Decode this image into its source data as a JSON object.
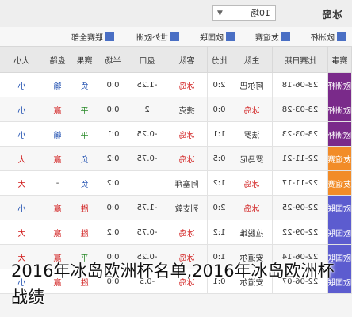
{
  "header": {
    "team": "冰岛",
    "dropdown_value": "10场",
    "filters": [
      "欧洲杯",
      "友谊赛",
      "欧国联",
      "世外欧洲",
      "联赛全部"
    ]
  },
  "table": {
    "columns": [
      "赛事",
      "比赛日期",
      "主队",
      "比分",
      "客队",
      "盘口",
      "半场",
      "赛果",
      "盘路",
      "大小"
    ],
    "rows": [
      {
        "comp": "欧洲杯",
        "date": "23-06-18",
        "home": "阿尔巴",
        "score": "2:0",
        "away": "冰岛",
        "line": "-1.25",
        "half": "0:0",
        "result": "负",
        "handicap": "输",
        "ou": "小"
      },
      {
        "comp": "欧洲杯",
        "date": "23-03-28",
        "home": "冰岛",
        "score": "0:0",
        "away": "捷克",
        "line": "2",
        "half": "0:0",
        "result": "平",
        "handicap": "赢",
        "ou": "小"
      },
      {
        "comp": "欧洲杯",
        "date": "23-03-23",
        "home": "法罗",
        "score": "1:1",
        "away": "冰岛",
        "line": "-0.25",
        "half": "0:1",
        "result": "平",
        "handicap": "输",
        "ou": "小"
      },
      {
        "comp": "友谊赛",
        "date": "22-11-21",
        "home": "罗马尼",
        "score": "0:5",
        "away": "冰岛",
        "line": "-0.75",
        "half": "0:2",
        "result": "负",
        "handicap": "赢",
        "ou": "大"
      },
      {
        "comp": "友谊赛",
        "date": "22-11-17",
        "home": "冰岛",
        "score": "1:2",
        "away": "阿塞拜",
        "line": "",
        "half": "0:2",
        "result": "负",
        "handicap": "-",
        "ou": "大"
      },
      {
        "comp": "欧国联",
        "date": "22-09-25",
        "home": "冰岛",
        "score": "2:0",
        "away": "列支敦",
        "line": "-1.75",
        "half": "0:0",
        "result": "胜",
        "handicap": "赢",
        "ou": "小"
      },
      {
        "comp": "欧国联",
        "date": "22-09-22",
        "home": "拉脱维",
        "score": "1:2",
        "away": "冰岛",
        "line": "-0.75",
        "half": "0:2",
        "result": "胜",
        "handicap": "赢",
        "ou": "大"
      },
      {
        "comp": "欧国联",
        "date": "22-06-14",
        "home": "安道尔",
        "score": "1:0",
        "away": "冰岛",
        "line": "-0.25",
        "half": "0:0",
        "result": "平",
        "handicap": "赢",
        "ou": "大"
      },
      {
        "comp": "欧国联",
        "date": "22-06-07",
        "home": "安道尔",
        "score": "0:1",
        "away": "冰岛",
        "line": "-0.5",
        "half": "0:0",
        "result": "胜",
        "handicap": "赢",
        "ou": "小"
      }
    ]
  },
  "caption": "2016年冰岛欧洲杯名单,2016年冰岛欧洲杯战绩",
  "colors": {
    "euro": "#7a2a8a",
    "friendly": "#f28c28",
    "nations": "#5c5ccf",
    "win": "#d01818",
    "lose": "#1f4fb0",
    "draw": "#2a8a2a"
  }
}
